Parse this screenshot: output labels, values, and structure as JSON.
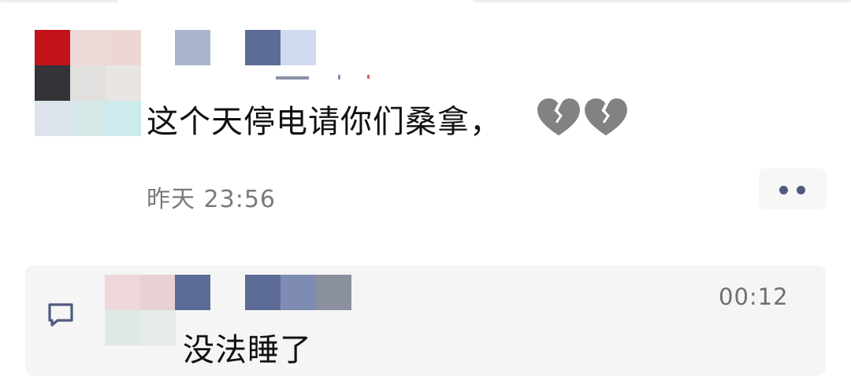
{
  "post": {
    "text": "这个天停电请你们桑拿，",
    "emoji_count": 2,
    "emoji_icon": "broken-heart-icon",
    "timestamp": "昨天 23:56"
  },
  "more_menu_icon": "more-dots-icon",
  "comment": {
    "icon": "comment-bubble-icon",
    "text": "没法睡了",
    "time": "00:12"
  },
  "colors": {
    "text_primary": "#111111",
    "text_secondary": "#7a7a7a",
    "accent": "#4f5a80",
    "panel_background": "#f5f5f5"
  }
}
